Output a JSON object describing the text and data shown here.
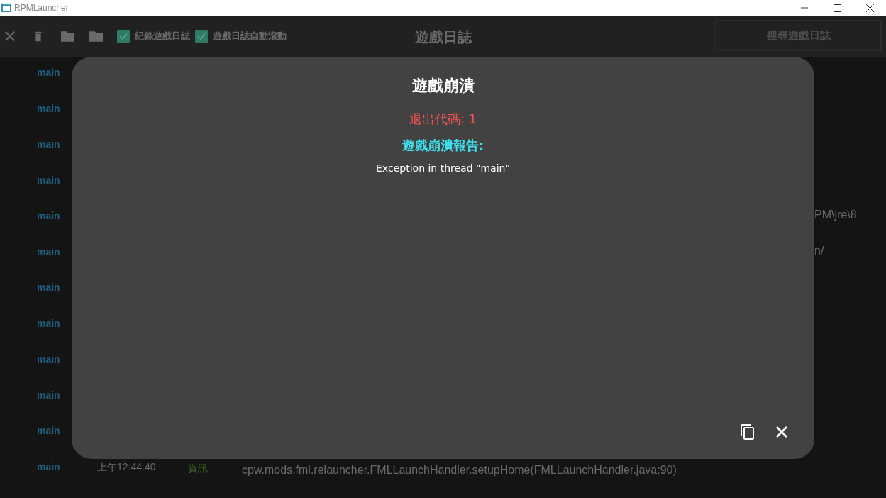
{
  "window": {
    "title": "RPMLauncher"
  },
  "toolbar": {
    "options": [
      {
        "label": "紀錄遊戲日誌",
        "checked": true
      },
      {
        "label": "遊戲日誌自動滾動",
        "checked": true
      }
    ],
    "title": "遊戲日誌",
    "search": {
      "placeholder": "搜尋遊戲日誌"
    }
  },
  "log": {
    "rows": [
      {
        "thread": "main"
      },
      {
        "thread": "main"
      },
      {
        "thread": "main"
      },
      {
        "thread": "main"
      },
      {
        "thread": "main",
        "message": "PM\\jre\\8"
      },
      {
        "thread": "main",
        "message": "n/"
      },
      {
        "thread": "main"
      },
      {
        "thread": "main"
      },
      {
        "thread": "main"
      },
      {
        "thread": "main"
      },
      {
        "thread": "main"
      },
      {
        "thread": "main",
        "time": "上午12:44:40",
        "level": "資訊",
        "message": "cpw.mods.fml.relauncher.FMLLaunchHandler.setupHome(FMLLaunchHandler.java:90)"
      }
    ]
  },
  "dialog": {
    "title": "遊戲崩潰",
    "exit_code": "退出代碼: 1",
    "report_label": "遊戲崩潰報告:",
    "report": "Exception in thread \"main\""
  }
}
